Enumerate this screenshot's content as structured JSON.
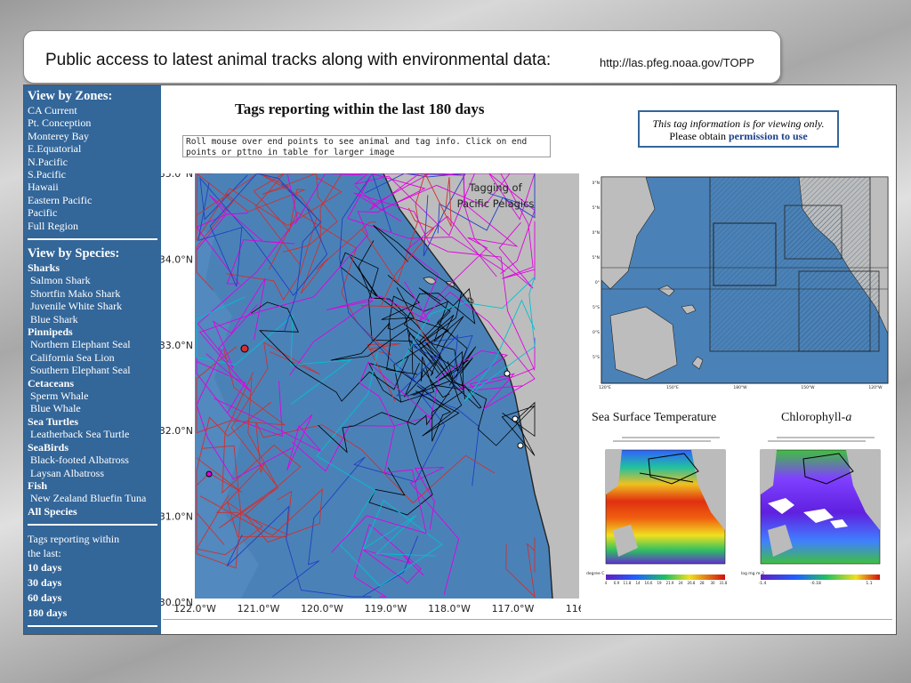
{
  "header": {
    "title": "Public access to latest animal tracks along with environmental data:",
    "url": "http://las.pfeg.noaa.gov/TOPP"
  },
  "sidebar": {
    "zones_heading": "View by Zones:",
    "zones": [
      "CA Current",
      "Pt. Conception",
      "Monterey Bay",
      "E.Equatorial",
      "N.Pacific",
      "S.Pacific",
      "Hawaii",
      "Eastern Pacific",
      "Pacific",
      "Full Region"
    ],
    "species_heading": "View by Species:",
    "species_groups": [
      {
        "group": "Sharks",
        "items": [
          "Salmon Shark",
          "Shortfin Mako Shark",
          "Juvenile White Shark",
          "Blue Shark"
        ]
      },
      {
        "group": "Pinnipeds",
        "items": [
          "Northern Elephant Seal",
          "California Sea Lion",
          "Southern Elephant Seal"
        ]
      },
      {
        "group": "Cetaceans",
        "items": [
          "Sperm Whale",
          "Blue Whale"
        ]
      },
      {
        "group": "Sea Turtles",
        "items": [
          "Leatherback Sea Turtle"
        ]
      },
      {
        "group": "SeaBirds",
        "items": [
          "Black-footed Albatross",
          "Laysan Albatross"
        ]
      },
      {
        "group": "Fish",
        "items": [
          "New Zealand Bluefin Tuna"
        ]
      }
    ],
    "all_species": "All Species",
    "reporting_label_1": "Tags reporting within",
    "reporting_label_2": "the last:",
    "day_options": [
      "10 days",
      "30 days",
      "60 days",
      "180 days"
    ]
  },
  "main": {
    "heading": "Tags reporting within the last 180 days",
    "hint_text": "Roll mouse over end points to see animal and tag info. Click on end points or pttno in table for larger image",
    "notice_italic": "This tag information is for viewing only.",
    "notice_prefix": "Please obtain",
    "notice_link": "permission to use",
    "map_label_1": "Tagging of",
    "map_label_2": "Pacific Pelagics",
    "lat_ticks": [
      "35.0°N",
      "34.0°N",
      "33.0°N",
      "32.0°N",
      "31.0°N",
      "30.0°N"
    ],
    "lon_ticks": [
      "122.0°W",
      "121.0°W",
      "120.0°W",
      "119.0°W",
      "118.0°W",
      "117.0°W",
      "116."
    ],
    "overview_lat_ticks": [
      "60°N",
      "45°N",
      "30°N",
      "15°N",
      "0°",
      "15°S",
      "30°S",
      "45°S"
    ],
    "overview_lon_ticks": [
      "120°E",
      "150°E",
      "180°W",
      "150°W",
      "120°W"
    ],
    "sst_title": "Sea Surface Temperature",
    "chl_title_prefix": "Chlorophyll-",
    "chl_title_italic": "a",
    "sst_units": "degree C",
    "chl_units": "log mg m-3",
    "sst_scale": [
      "4",
      "6.9",
      "11.8",
      "14",
      "16.6",
      "19",
      "21.9",
      "24",
      "26.8",
      "28",
      "30",
      "31.8"
    ],
    "chl_scale": [
      "-1.4",
      "-0.18",
      "1.1"
    ]
  },
  "colors": {
    "sidebar_bg": "#336699",
    "ocean": "#4a82b8",
    "land": "#bdbdbd",
    "track_black": "#000000",
    "track_magenta": "#e000e0",
    "track_red": "#d03030",
    "track_blue": "#2040c0",
    "track_cyan": "#00c0d0"
  }
}
